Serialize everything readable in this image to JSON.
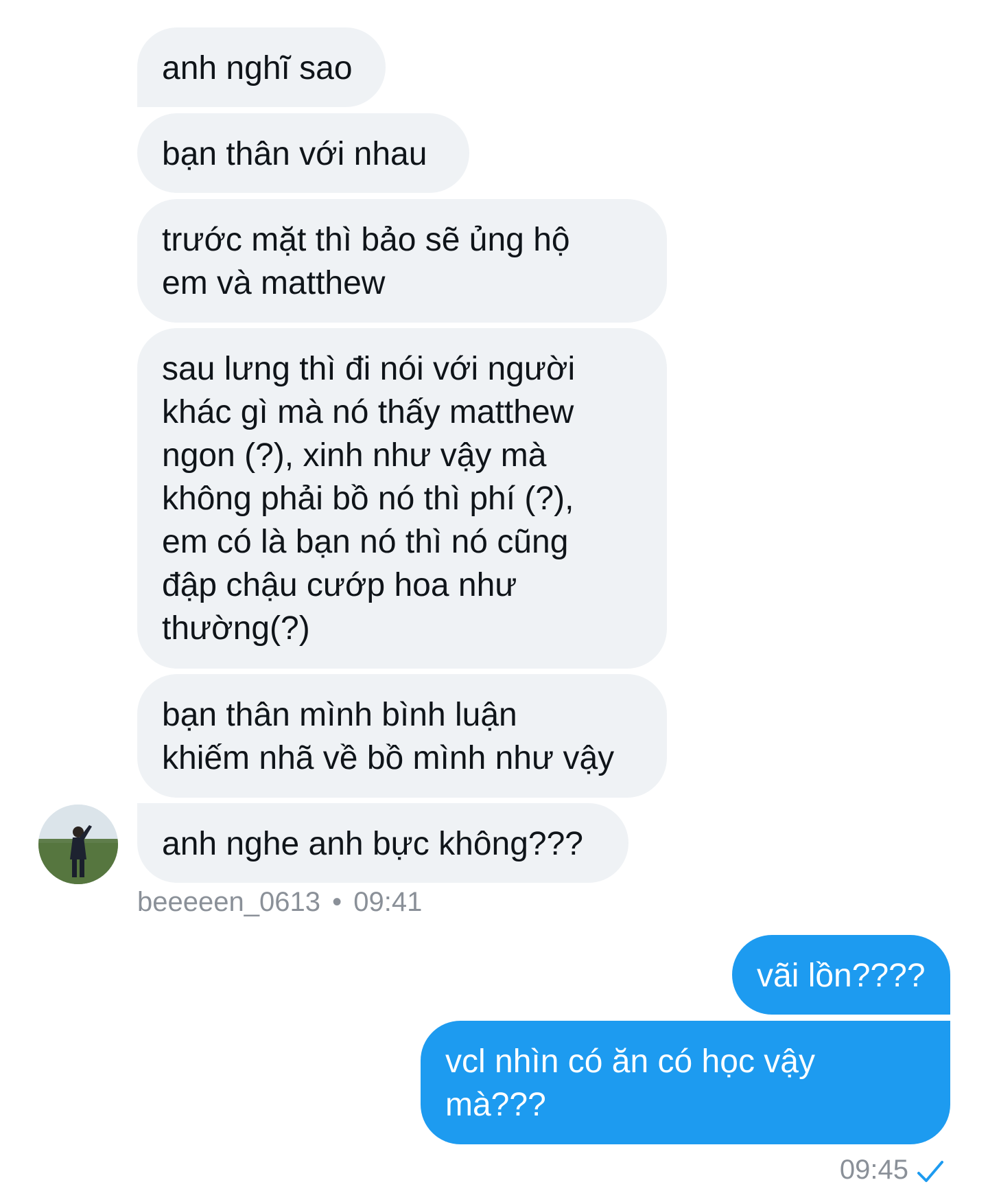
{
  "conversation": {
    "received": [
      {
        "text": "anh nghĩ sao"
      },
      {
        "text": "bạn thân với nhau"
      },
      {
        "text": "trước mặt thì bảo sẽ ủng hộ\nem và matthew"
      },
      {
        "text": "sau lưng thì đi nói với người\nkhác gì mà nó thấy matthew\nngon (?), xinh như vậy mà\nkhông phải bồ nó thì phí (?),\nem có là bạn nó thì nó cũng\nđập chậu cướp hoa như\nthường(?)"
      },
      {
        "text": "bạn thân mình bình luận\nkhiếm nhã về bồ mình như vậy"
      },
      {
        "text": "anh nghe anh bực không???"
      }
    ],
    "received_meta": {
      "username": "beeeeen_0613",
      "separator": "•",
      "time": "09:41"
    },
    "sent": [
      {
        "text": "vãi lồn????"
      },
      {
        "text": "vcl nhìn có ăn có học vậy\nmà???"
      }
    ],
    "sent_meta": {
      "time": "09:45",
      "status_icon": "read-check-icon"
    }
  },
  "colors": {
    "received_bubble": "#eff2f5",
    "sent_bubble": "#1d9bf0",
    "meta_text": "#8a9098",
    "check": "#1d9bf0"
  }
}
